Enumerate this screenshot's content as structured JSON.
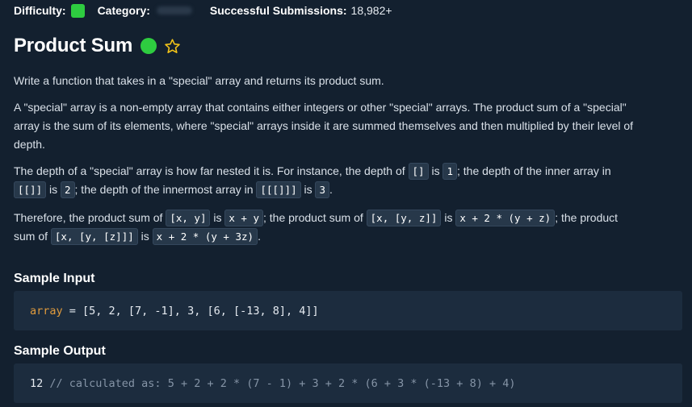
{
  "meta": {
    "difficulty_label": "Difficulty:",
    "difficulty_color": "#2ecc40",
    "category_label": "Category:",
    "submissions_label": "Successful Submissions:",
    "submissions_value": "18,982+"
  },
  "problem": {
    "title": "Product Sum",
    "status_color": "#2ecc40",
    "star_color": "#f5c518",
    "status_icon": "completed-dot-icon",
    "favorite_icon": "star-outline-icon"
  },
  "description": {
    "p1": "Write a function that takes in a \"special\" array and returns its product sum.",
    "p2_line1": "A \"special\" array is a non-empty array that contains either integers or other \"special\" arrays. The product sum of a \"special\"",
    "p2_line2": "array is the sum of its elements, where \"special\" arrays inside it are summed themselves and then multiplied by their level of",
    "p2_line3": "depth.",
    "p3_t1": "The depth of a \"special\" array is how far nested it is. For instance, the depth of ",
    "p3_c1": "[]",
    "p3_t2": " is ",
    "p3_c2": "1",
    "p3_t3": "; the depth of the inner array in",
    "p3_c3": "[[]]",
    "p3_t4": " is ",
    "p3_c4": "2",
    "p3_t5": "; the depth of the innermost array in ",
    "p3_c5": "[[[]]]",
    "p3_t6": " is ",
    "p3_c6": "3",
    "p3_t7": ".",
    "p4_t1": "Therefore, the product sum of ",
    "p4_c1": "[x, y]",
    "p4_t2": " is ",
    "p4_c2": "x + y",
    "p4_t3": "; the product sum of ",
    "p4_c3": "[x, [y, z]]",
    "p4_t4": " is ",
    "p4_c4": "x + 2 * (y + z)",
    "p4_t5": "; the product",
    "p4_t6": "sum of ",
    "p4_c5": "[x, [y, [z]]]",
    "p4_t7": " is ",
    "p4_c6": "x + 2 * (y + 3z)",
    "p4_t8": "."
  },
  "sample_input": {
    "heading": "Sample Input",
    "var": "array",
    "rest": " = [5, 2, [7, -1], 3, [6, [-13, 8], 4]]"
  },
  "sample_output": {
    "heading": "Sample Output",
    "value": "12",
    "comment": " // calculated as: 5 + 2 + 2 * (7 - 1) + 3 + 2 * (6 + 3 * (-13 + 8) + 4)"
  }
}
